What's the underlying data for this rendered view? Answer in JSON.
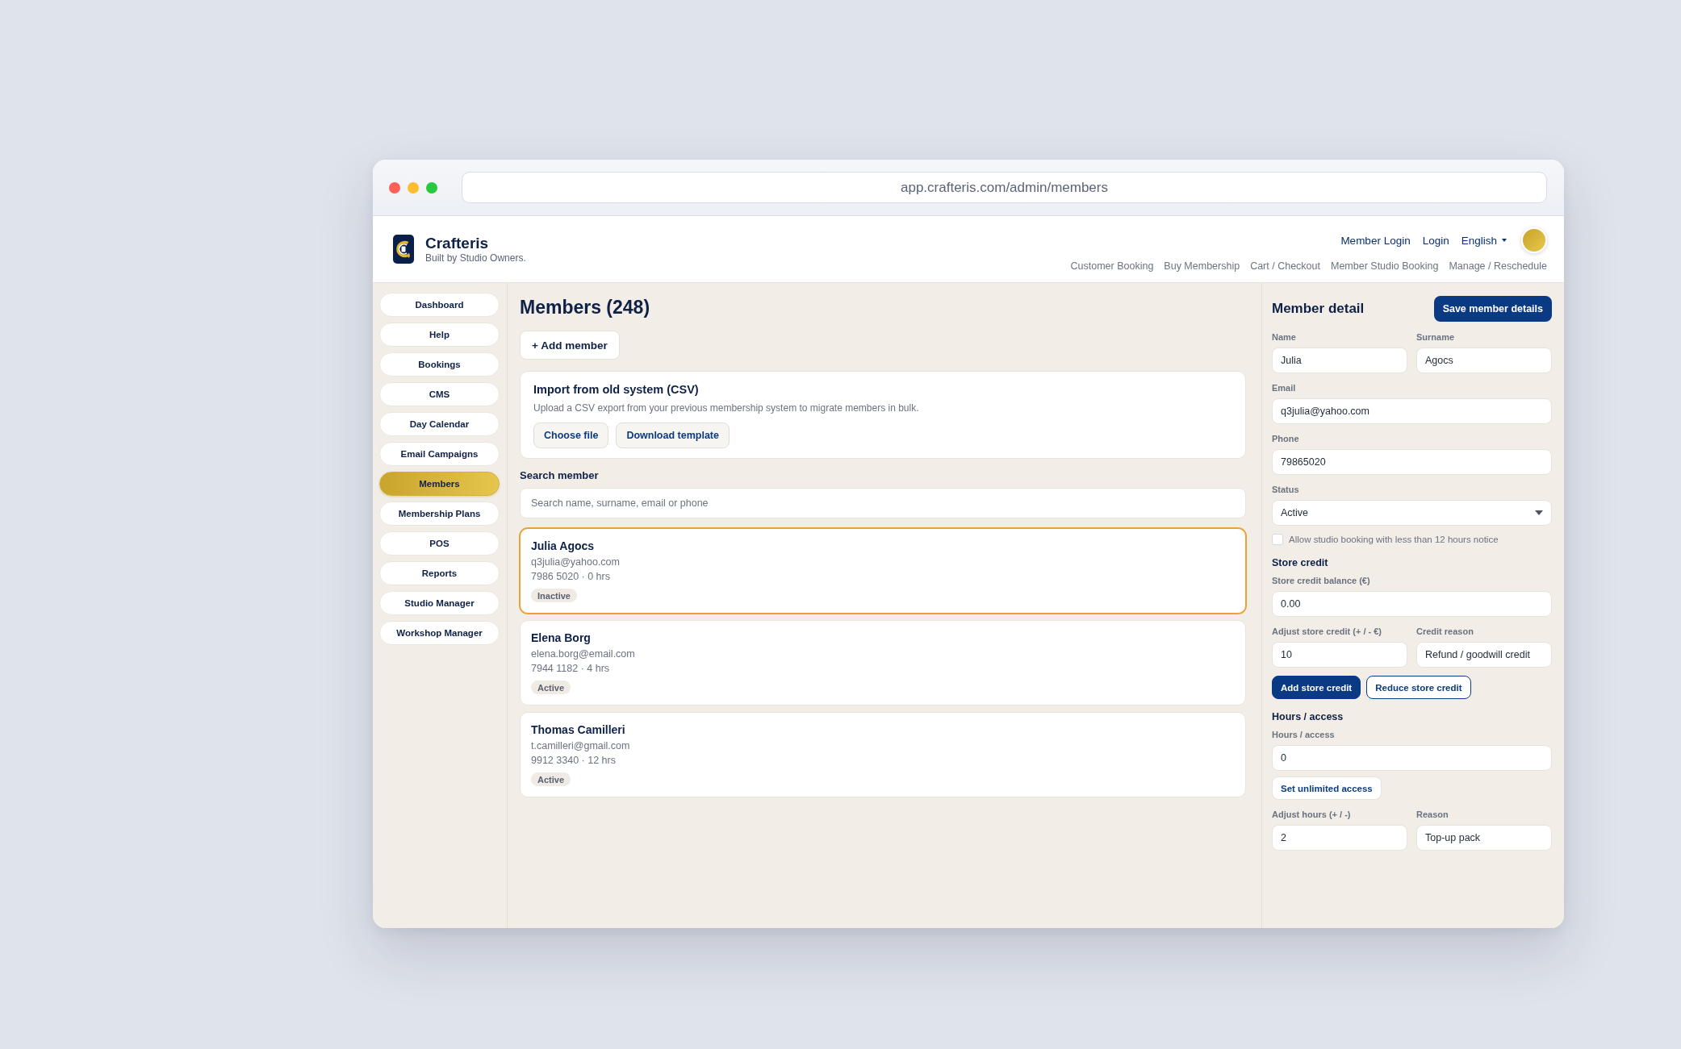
{
  "browser": {
    "url": "app.crafteris.com/admin/members"
  },
  "header": {
    "brand": {
      "name": "Crafteris",
      "tagline": "Built by Studio Owners."
    },
    "top_links": [
      "Member Login",
      "Login"
    ],
    "language": "English",
    "nav_links": [
      "Customer Booking",
      "Buy Membership",
      "Cart / Checkout",
      "Member Studio Booking",
      "Manage / Reschedule"
    ]
  },
  "sidebar": {
    "items": [
      {
        "label": "Dashboard",
        "selected": false
      },
      {
        "label": "Help",
        "selected": false
      },
      {
        "label": "Bookings",
        "selected": false
      },
      {
        "label": "CMS",
        "selected": false
      },
      {
        "label": "Day Calendar",
        "selected": false
      },
      {
        "label": "Email Campaigns",
        "selected": false
      },
      {
        "label": "Members",
        "selected": true
      },
      {
        "label": "Membership Plans",
        "selected": false
      },
      {
        "label": "POS",
        "selected": false
      },
      {
        "label": "Reports",
        "selected": false
      },
      {
        "label": "Studio Manager",
        "selected": false
      },
      {
        "label": "Workshop Manager",
        "selected": false
      }
    ]
  },
  "members": {
    "title": "Members (248)",
    "add_button": "+ Add member",
    "import": {
      "title": "Import from old system (CSV)",
      "description": "Upload a CSV export from your previous membership system to migrate members in bulk.",
      "buttons": [
        "Choose file",
        "Download template"
      ]
    },
    "search": {
      "label": "Search member",
      "placeholder": "Search name, surname, email or phone"
    },
    "list": [
      {
        "name": "Julia Agocs",
        "email": "q3julia@yahoo.com",
        "details": "7986 5020 · 0 hrs",
        "status": "Inactive",
        "selected": true
      },
      {
        "name": "Elena Borg",
        "email": "elena.borg@email.com",
        "details": "7944 1182 · 4 hrs",
        "status": "Active",
        "selected": false
      },
      {
        "name": "Thomas Camilleri",
        "email": "t.camilleri@gmail.com",
        "details": "9912 3340 · 12 hrs",
        "status": "Active",
        "selected": false
      }
    ]
  },
  "detail": {
    "title": "Member detail",
    "save_button": "Save member details",
    "rows": [
      {
        "kind": "fields",
        "fields": [
          {
            "label": "Name",
            "value": "Julia"
          },
          {
            "label": "Surname",
            "value": "Agocs"
          }
        ]
      },
      {
        "kind": "fields",
        "fields": [
          {
            "label": "Email",
            "value": "q3julia@yahoo.com"
          }
        ]
      },
      {
        "kind": "fields",
        "fields": [
          {
            "label": "Phone",
            "value": "79865020"
          }
        ]
      },
      {
        "kind": "select",
        "label": "Status",
        "value": "Active"
      },
      {
        "kind": "checkbox",
        "label": "Allow studio booking with less than 12 hours notice",
        "checked": false
      },
      {
        "kind": "heading",
        "text": "Store credit"
      },
      {
        "kind": "fields",
        "fields": [
          {
            "label": "Store credit balance (€)",
            "value": "0.00"
          }
        ]
      },
      {
        "kind": "fields",
        "fields": [
          {
            "label": "Adjust store credit (+ / - €)",
            "value": "10"
          },
          {
            "label": "Credit reason",
            "value": "Refund / goodwill credit"
          }
        ]
      },
      {
        "kind": "buttons",
        "buttons": [
          {
            "label": "Add store credit",
            "kind": "primary"
          },
          {
            "label": "Reduce store credit",
            "kind": "outline"
          }
        ]
      },
      {
        "kind": "heading",
        "text": "Hours / access"
      },
      {
        "kind": "fields",
        "fields": [
          {
            "label": "Hours / access",
            "value": "0"
          }
        ]
      },
      {
        "kind": "buttons",
        "buttons": [
          {
            "label": "Set unlimited access",
            "kind": "light"
          }
        ]
      },
      {
        "kind": "fields",
        "fields": [
          {
            "label": "Adjust hours (+ / -)",
            "value": "2"
          },
          {
            "label": "Reason",
            "value": "Top-up pack"
          }
        ]
      }
    ]
  }
}
